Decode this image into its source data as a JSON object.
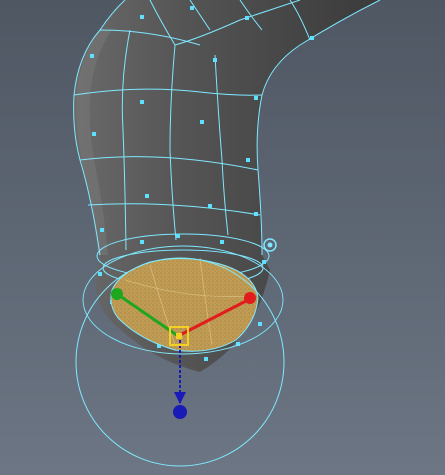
{
  "viewport": {
    "background_top": "#4f5763",
    "background_bottom": "#6c7684"
  },
  "mesh": {
    "shaded_color": "#4b4b4b",
    "highlight_color": "#7a7a7a",
    "wireframe_color": "#7fe8ff",
    "face_dot_color": "#5fe0ff",
    "selected_face_color": "#d8b36a"
  },
  "manipulator": {
    "x_axis_color": "#e11c1c",
    "y_axis_color": "#1ea61e",
    "z_axis_color": "#1a1ab8",
    "center_handle_color": "#f2d024",
    "rotate_ring_color": "#7fe8ff"
  },
  "icons": {
    "pivot": "pivot-icon",
    "center": "move-center-handle-icon"
  }
}
